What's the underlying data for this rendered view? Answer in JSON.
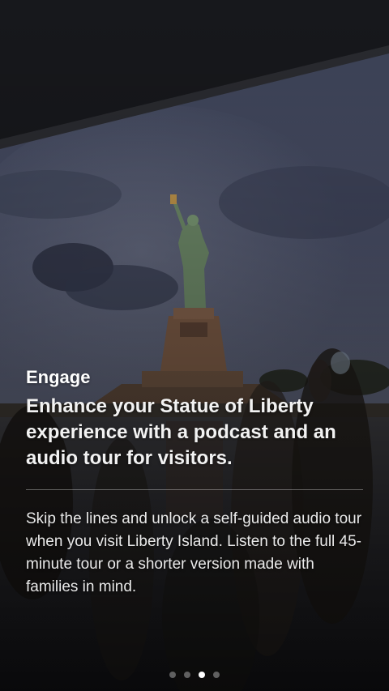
{
  "onboarding": {
    "eyebrow": "Engage",
    "headline": "Enhance your Statue of Liberty experience with a podcast and an audio tour for visitors.",
    "body": "Skip the lines and unlock a self-guided audio tour when you visit Liberty Island. Listen to the full 45-minute tour or a shorter version made with families in mind.",
    "page_indicator": {
      "count": 4,
      "active_index": 2
    }
  },
  "colors": {
    "text": "#ffffff",
    "dot_inactive": "rgba(255,255,255,0.35)",
    "dot_active": "#ffffff"
  }
}
